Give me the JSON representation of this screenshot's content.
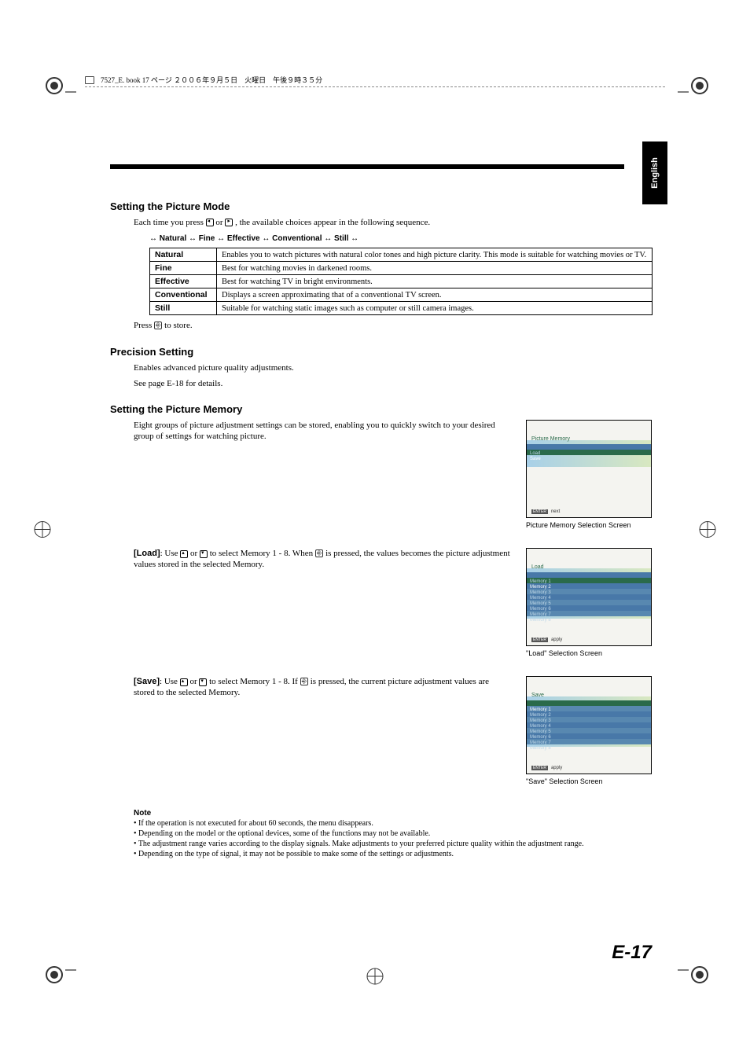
{
  "header_text": "7527_E. book  17 ページ  ２００６年９月５日　火曜日　午後９時３５分",
  "side_tab": "English",
  "sections": {
    "picture_mode": {
      "title": "Setting the Picture Mode",
      "intro_pre": "Each time you press ",
      "intro_mid": " or ",
      "intro_post": " , the available choices appear in the following sequence.",
      "sequence": "↔ Natural ↔ Fine ↔ Effective ↔ Conventional ↔ Still ↔",
      "rows": [
        {
          "label": "Natural",
          "desc": "Enables you to watch pictures with natural color tones and high picture clarity. This mode is suitable for watching movies or TV."
        },
        {
          "label": "Fine",
          "desc": "Best for watching movies in darkened rooms."
        },
        {
          "label": "Effective",
          "desc": "Best for watching TV in bright environments."
        },
        {
          "label": "Conventional",
          "desc": "Displays a screen approximating that of a conventional TV screen."
        },
        {
          "label": "Still",
          "desc": "Suitable for watching static images such as computer or still camera images."
        }
      ],
      "press_pre": "Press ",
      "press_post": " to store."
    },
    "precision": {
      "title": "Precision Setting",
      "line1": "Enables advanced picture quality adjustments.",
      "line2": "See page E-18 for details."
    },
    "memory": {
      "title": "Setting the Picture Memory",
      "intro": "Eight groups of picture adjustment settings can be stored, enabling you to quickly switch to your desired group of settings for watching picture.",
      "load_label": "[Load]",
      "load_pre": ": Use ",
      "load_mid1": " or ",
      "load_mid2": " to select Memory 1 - 8. When ",
      "load_post": " is pressed, the values becomes the picture adjustment values stored in the selected Memory.",
      "save_label": "[Save]",
      "save_pre": ": Use ",
      "save_mid1": " or ",
      "save_mid2": " to select Memory 1 - 8. If ",
      "save_post": " is pressed, the current picture adjustment values are stored to the selected Memory.",
      "captions": {
        "c1": "Picture Memory Selection Screen",
        "c2": "\"Load\" Selection Screen",
        "c3": "\"Save\" Selection Screen"
      },
      "screens": {
        "s1": {
          "title": "Picture Memory",
          "rows": [
            "Load",
            "Save"
          ],
          "bottom": "next",
          "badge": "ENTER"
        },
        "s2": {
          "title": "Load",
          "rows": [
            "Memory 1",
            "Memory 2",
            "Memory 3",
            "Memory 4",
            "Memory 5",
            "Memory 6",
            "Memory 7",
            "Memory 8"
          ],
          "bottom": "apply",
          "badge": "ENTER"
        },
        "s3": {
          "title": "Save",
          "rows": [
            "Memory 1",
            "Memory 2",
            "Memory 3",
            "Memory 4",
            "Memory 5",
            "Memory 6",
            "Memory 7",
            "Memory 8"
          ],
          "bottom": "apply",
          "badge": "ENTER"
        }
      }
    }
  },
  "note": {
    "title": "Note",
    "items": [
      "If the operation is not executed for about 60 seconds, the menu disappears.",
      "Depending on the model or the optional devices, some of the functions may not be available.",
      "The adjustment range varies according to the display signals. Make adjustments to your preferred picture quality within the adjustment range.",
      "Depending on the type of signal, it may not be possible to make some of the settings or adjustments."
    ]
  },
  "page_number": "E-17"
}
